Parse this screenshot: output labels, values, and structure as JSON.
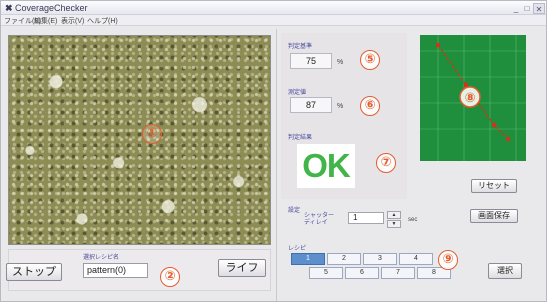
{
  "window": {
    "title": "CoverageChecker",
    "controls": {
      "minimize": "_",
      "maximize": "□",
      "close": "✕"
    }
  },
  "menu": {
    "items": [
      "ファイル(F)",
      "編集(E)",
      "表示(V)",
      "ヘルプ(H)"
    ]
  },
  "camera": {
    "marker": "①"
  },
  "capture": {
    "stop_label": "ストップ",
    "level_caption": "選択レシピ名",
    "level_value": "pattern(0)",
    "live_label": "ライフ",
    "marker": "②"
  },
  "measurements": {
    "coverage_label": "判定基準",
    "coverage_value": "75",
    "coverage_unit": "%",
    "coverage_marker": "⑤",
    "measured_label": "測定値",
    "measured_value": "87",
    "measured_unit": "%",
    "measured_marker": "⑥",
    "result_label": "判定結果",
    "result_value": "OK",
    "result_marker": "⑦"
  },
  "graph": {
    "marker": "⑧",
    "background_color": "#1f8f3d",
    "line_color": "#d23418"
  },
  "actions": {
    "reset_label": "リセット",
    "save_label": "画面保存"
  },
  "settings": {
    "label": "設定",
    "shutter_label": "シャッター\nディレイ",
    "shutter_value": "1",
    "shutter_unit": "sec",
    "spin_up": "▲",
    "spin_down": "▼"
  },
  "select": {
    "label": "レシピ",
    "row1": [
      "1",
      "2",
      "3",
      "4"
    ],
    "row2": [
      "5",
      "6",
      "7",
      "8"
    ],
    "active": "1",
    "marker": "⑨",
    "button_label": "選択"
  }
}
